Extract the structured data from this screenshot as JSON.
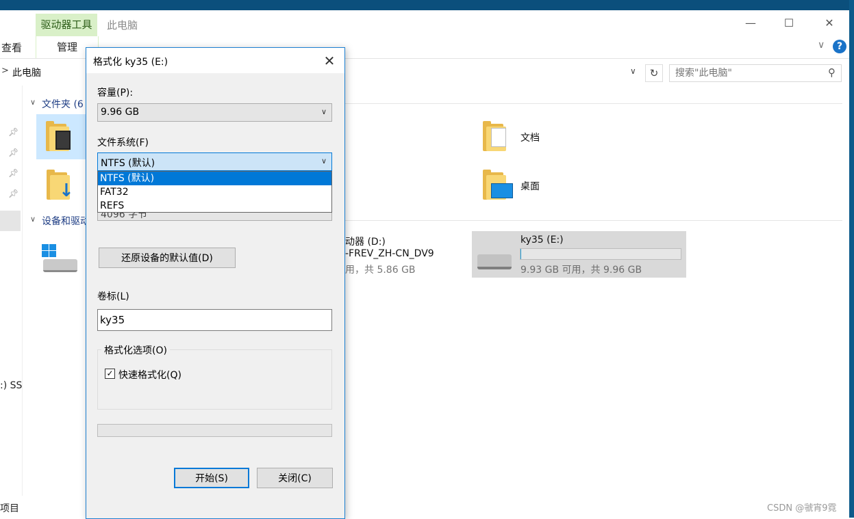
{
  "window": {
    "title": "此电脑",
    "ribbon_context_tab": "驱动器工具",
    "ribbon_tab_manage": "管理",
    "ribbon_tab_view": "查看",
    "minimize_glyph": "—",
    "maximize_glyph": "☐",
    "close_glyph": "✕",
    "help_glyph": "?",
    "expand_glyph": "∨"
  },
  "address_bar": {
    "path": "此电脑",
    "chevron": ">",
    "dropdown_glyph": "∨",
    "refresh_glyph": "↻",
    "search_placeholder": "搜索\"此电脑\"",
    "search_glyph": "⚲"
  },
  "nav": {
    "ssd_fragment": ":) SS",
    "status_fragment": "项目"
  },
  "content": {
    "group_folders": "文件夹 (6",
    "group_devices": "设备和驱动",
    "folders": [
      {
        "label": "文档"
      },
      {
        "label": "桌面"
      }
    ],
    "drive_d": {
      "name": "动器 (D:)",
      "volume": "-FREV_ZH-CN_DV9",
      "space": "用，共 5.86 GB"
    },
    "drive_e": {
      "name": "ky35 (E:)",
      "space": "9.93 GB 可用，共 9.96 GB",
      "used_fraction": 0.003
    }
  },
  "dialog": {
    "title": "格式化 ky35 (E:)",
    "close_glyph": "✕",
    "capacity_label": "容量(P):",
    "capacity_value": "9.96 GB",
    "filesystem_label": "文件系统(F)",
    "filesystem_value": "NTFS (默认)",
    "filesystem_options": [
      "NTFS (默认)",
      "FAT32",
      "REFS"
    ],
    "alloc_fragment": "4096 字节",
    "restore_button": "还原设备的默认值(D)",
    "volume_label": "卷标(L)",
    "volume_value": "ky35",
    "options_group": "格式化选项(O)",
    "quick_format": "快速格式化(Q)",
    "quick_format_checked": true,
    "start_button": "开始(S)",
    "close_button": "关闭(C)",
    "dropdown_glyph": "∨",
    "check_glyph": "✓"
  },
  "watermark": "CSDN @虢宵9霓",
  "colors": {
    "accent": "#0078d7",
    "ribbon_context": "#d9f0c8",
    "folder_yellow": "#f8d775"
  }
}
